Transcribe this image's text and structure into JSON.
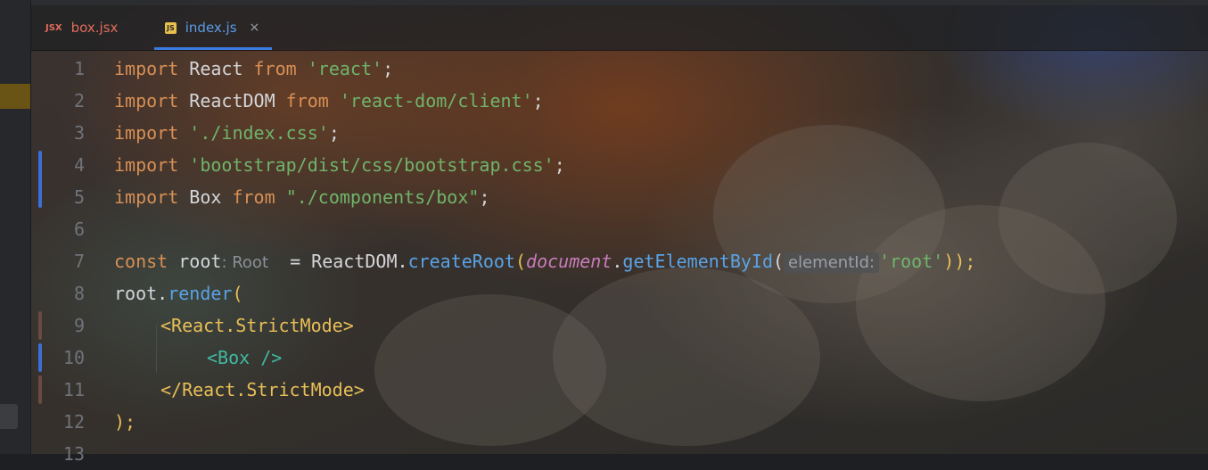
{
  "tabs": [
    {
      "icon": "JSX",
      "label": "box.jsx"
    },
    {
      "icon": "JS",
      "label": "index.js",
      "close": "×"
    }
  ],
  "line_numbers": [
    "1",
    "2",
    "3",
    "4",
    "5",
    "6",
    "7",
    "8",
    "9",
    "10",
    "11",
    "12",
    "13"
  ],
  "code": {
    "l1": {
      "kw": "import",
      "a": " React ",
      "kw2": "from",
      "sp": " ",
      "str": "'react'",
      "end": ";"
    },
    "l2": {
      "kw": "import",
      "a": " ReactDOM ",
      "kw2": "from",
      "sp": " ",
      "str": "'react-dom/client'",
      "end": ";"
    },
    "l3": {
      "kw": "import",
      "sp": " ",
      "str": "'./index.css'",
      "end": ";"
    },
    "l4": {
      "kw": "import",
      "sp": " ",
      "str": "'bootstrap/dist/css/bootstrap.css'",
      "end": ";"
    },
    "l5": {
      "kw": "import",
      "a": " Box ",
      "kw2": "from",
      "sp": " ",
      "str": "\"./components/box\"",
      "end": ";"
    },
    "l7": {
      "kw": "const",
      "a": " root",
      "hint": ": Root",
      "b": "  = ReactDOM.",
      "fn": "createRoot",
      "p1": "(",
      "it": "document",
      "dot": ".",
      "fn2": "getElementById",
      "p2": "(",
      "hint2": "elementId:",
      "str": "'root'",
      "end": "));"
    },
    "l8": {
      "a": "root.",
      "fn": "render",
      "p": "("
    },
    "l9": {
      "tag": "<React.StrictMode>"
    },
    "l10": {
      "comp": "<Box />"
    },
    "l11": {
      "tag": "</React.StrictMode>"
    },
    "l12": {
      "end": ");"
    }
  },
  "colors": {
    "keyword": "#d89055",
    "string": "#6fb46a",
    "function": "#5aa3e6",
    "tab_active": "#3d7be0"
  }
}
